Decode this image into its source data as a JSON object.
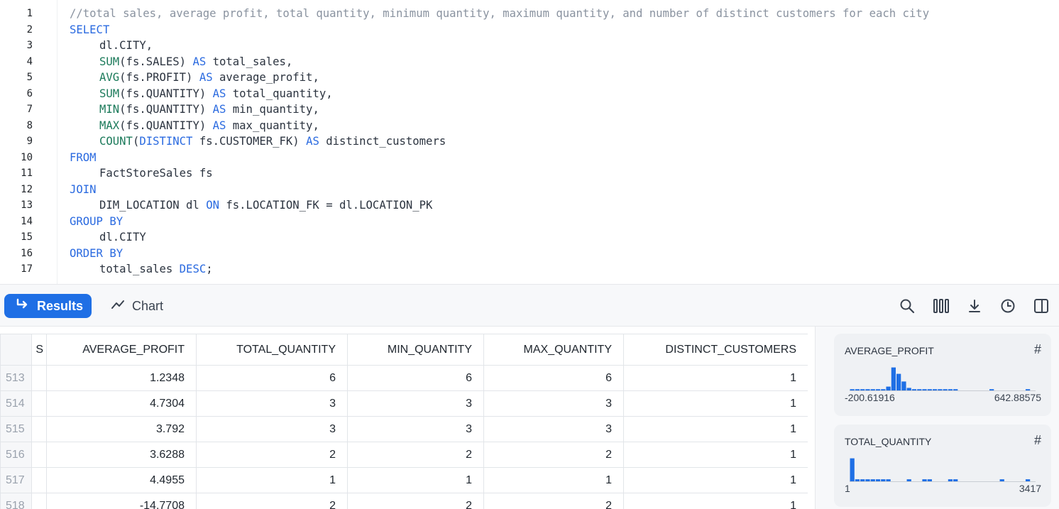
{
  "editor": {
    "lines": [
      {
        "n": "1",
        "indent": false,
        "tokens": [
          {
            "t": "cm",
            "v": "//total sales, average profit, total quantity, minimum quantity, maximum quantity, and number of distinct customers for each city"
          }
        ]
      },
      {
        "n": "2",
        "indent": false,
        "tokens": [
          {
            "t": "kw",
            "v": "SELECT"
          }
        ]
      },
      {
        "n": "3",
        "indent": true,
        "tokens": [
          {
            "t": "id",
            "v": "dl.CITY,"
          }
        ]
      },
      {
        "n": "4",
        "indent": true,
        "tokens": [
          {
            "t": "fn",
            "v": "SUM"
          },
          {
            "t": "id",
            "v": "(fs.SALES) "
          },
          {
            "t": "kw",
            "v": "AS"
          },
          {
            "t": "id",
            "v": " total_sales,"
          }
        ]
      },
      {
        "n": "5",
        "indent": true,
        "tokens": [
          {
            "t": "fn",
            "v": "AVG"
          },
          {
            "t": "id",
            "v": "(fs.PROFIT) "
          },
          {
            "t": "kw",
            "v": "AS"
          },
          {
            "t": "id",
            "v": " average_profit,"
          }
        ]
      },
      {
        "n": "6",
        "indent": true,
        "tokens": [
          {
            "t": "fn",
            "v": "SUM"
          },
          {
            "t": "id",
            "v": "(fs.QUANTITY) "
          },
          {
            "t": "kw",
            "v": "AS"
          },
          {
            "t": "id",
            "v": " total_quantity,"
          }
        ]
      },
      {
        "n": "7",
        "indent": true,
        "tokens": [
          {
            "t": "fn",
            "v": "MIN"
          },
          {
            "t": "id",
            "v": "(fs.QUANTITY) "
          },
          {
            "t": "kw",
            "v": "AS"
          },
          {
            "t": "id",
            "v": " min_quantity,"
          }
        ]
      },
      {
        "n": "8",
        "indent": true,
        "tokens": [
          {
            "t": "fn",
            "v": "MAX"
          },
          {
            "t": "id",
            "v": "(fs.QUANTITY) "
          },
          {
            "t": "kw",
            "v": "AS"
          },
          {
            "t": "id",
            "v": " max_quantity,"
          }
        ]
      },
      {
        "n": "9",
        "indent": true,
        "tokens": [
          {
            "t": "fn",
            "v": "COUNT"
          },
          {
            "t": "id",
            "v": "("
          },
          {
            "t": "kw",
            "v": "DISTINCT"
          },
          {
            "t": "id",
            "v": " fs.CUSTOMER_FK) "
          },
          {
            "t": "kw",
            "v": "AS"
          },
          {
            "t": "id",
            "v": " distinct_customers"
          }
        ]
      },
      {
        "n": "10",
        "indent": false,
        "tokens": [
          {
            "t": "kw",
            "v": "FROM"
          }
        ]
      },
      {
        "n": "11",
        "indent": true,
        "tokens": [
          {
            "t": "id",
            "v": "FactStoreSales fs"
          }
        ]
      },
      {
        "n": "12",
        "indent": false,
        "tokens": [
          {
            "t": "kw",
            "v": "JOIN"
          }
        ]
      },
      {
        "n": "13",
        "indent": true,
        "tokens": [
          {
            "t": "id",
            "v": "DIM_LOCATION dl "
          },
          {
            "t": "kw",
            "v": "ON"
          },
          {
            "t": "id",
            "v": " fs.LOCATION_FK = dl.LOCATION_PK"
          }
        ]
      },
      {
        "n": "14",
        "indent": false,
        "tokens": [
          {
            "t": "kw",
            "v": "GROUP BY"
          }
        ]
      },
      {
        "n": "15",
        "indent": true,
        "tokens": [
          {
            "t": "id",
            "v": "dl.CITY"
          }
        ]
      },
      {
        "n": "16",
        "indent": false,
        "tokens": [
          {
            "t": "kw",
            "v": "ORDER BY"
          }
        ]
      },
      {
        "n": "17",
        "indent": true,
        "tokens": [
          {
            "t": "id",
            "v": "total_sales "
          },
          {
            "t": "kw",
            "v": "DESC"
          },
          {
            "t": "id",
            "v": ";"
          }
        ]
      }
    ]
  },
  "toolbar": {
    "results_label": "Results",
    "chart_label": "Chart",
    "icons": [
      "search-icon",
      "columns-icon",
      "download-icon",
      "history-icon",
      "panel-toggle-icon"
    ]
  },
  "table": {
    "columns": [
      "",
      "S",
      "AVERAGE_PROFIT",
      "TOTAL_QUANTITY",
      "MIN_QUANTITY",
      "MAX_QUANTITY",
      "DISTINCT_CUSTOMERS"
    ],
    "rows": [
      {
        "num": "513",
        "cells": [
          "1.2348",
          "6",
          "6",
          "6",
          "1"
        ]
      },
      {
        "num": "514",
        "cells": [
          "4.7304",
          "3",
          "3",
          "3",
          "1"
        ]
      },
      {
        "num": "515",
        "cells": [
          "3.792",
          "3",
          "3",
          "3",
          "1"
        ]
      },
      {
        "num": "516",
        "cells": [
          "3.6288",
          "2",
          "2",
          "2",
          "1"
        ]
      },
      {
        "num": "517",
        "cells": [
          "4.4955",
          "1",
          "1",
          "1",
          "1"
        ]
      },
      {
        "num": "518",
        "cells": [
          "-14.7708",
          "2",
          "2",
          "2",
          "1"
        ]
      }
    ]
  },
  "side_panel": {
    "cards": [
      {
        "title": "AVERAGE_PROFIT",
        "hash": "#",
        "min": "-200.61916",
        "max": "642.88575",
        "bins": [
          0.05,
          0.05,
          0.05,
          0.05,
          0.05,
          0.05,
          0.05,
          0.15,
          0.9,
          0.65,
          0.35,
          0.1,
          0.05,
          0.05,
          0.05,
          0.05,
          0.05,
          0.05,
          0.05,
          0.05,
          0.05,
          0,
          0,
          0,
          0,
          0,
          0,
          0.05,
          0,
          0,
          0,
          0,
          0,
          0,
          0.05,
          0
        ]
      },
      {
        "title": "TOTAL_QUANTITY",
        "hash": "#",
        "min": "1",
        "max": "3417",
        "bins": [
          0.9,
          0.08,
          0.08,
          0.08,
          0.08,
          0.08,
          0.08,
          0.08,
          0,
          0,
          0,
          0.08,
          0,
          0,
          0.08,
          0.08,
          0,
          0,
          0,
          0.08,
          0.08,
          0,
          0,
          0,
          0,
          0,
          0,
          0,
          0,
          0.08,
          0,
          0,
          0,
          0,
          0.08,
          0
        ]
      }
    ],
    "accent": "#1f6fe5"
  }
}
